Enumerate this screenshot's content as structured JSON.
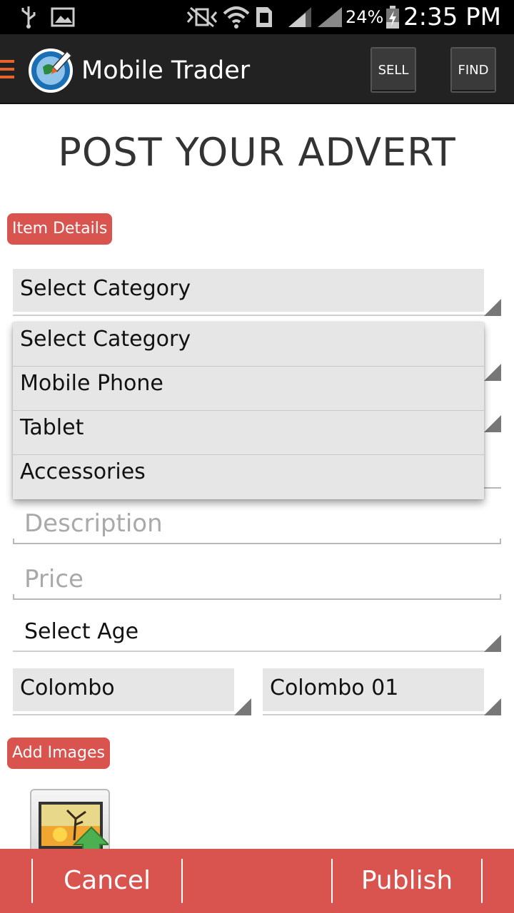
{
  "status_bar": {
    "battery_percent": "24%",
    "time": "2:35 PM"
  },
  "action_bar": {
    "title": "Mobile Trader",
    "sell_label": "SELL",
    "find_label": "FIND"
  },
  "page": {
    "title": "POST YOUR ADVERT"
  },
  "item_details": {
    "badge": "Item Details",
    "category_spinner_value": "Select Category",
    "category_options": [
      "Select Category",
      "Mobile Phone",
      "Tablet",
      "Accessories"
    ],
    "description_placeholder": "Description",
    "price_placeholder": "Price",
    "age_spinner_value": "Select Age",
    "district_value": "Colombo",
    "city_value": "Colombo 01"
  },
  "images": {
    "badge": "Add Images"
  },
  "bottom_bar": {
    "cancel_label": "Cancel",
    "publish_label": "Publish"
  },
  "colors": {
    "accent": "#d9534f",
    "action_bar": "#222222",
    "menu_icon": "#e8622a"
  }
}
